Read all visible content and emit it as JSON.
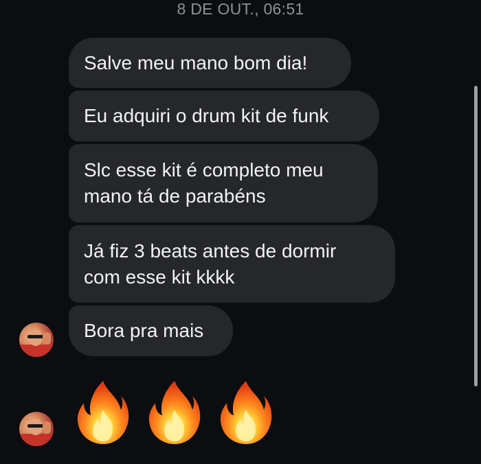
{
  "chat": {
    "timestamp": "8 DE OUT., 06:51",
    "messages": [
      {
        "lines": [
          "Salve meu mano bom dia!"
        ]
      },
      {
        "lines": [
          "Eu adquiri o drum kit de funk"
        ]
      },
      {
        "lines": [
          "Slc esse kit é completo meu",
          "mano tá de parabéns"
        ]
      },
      {
        "lines": [
          "Já fiz 3 beats antes de dormir",
          "com esse kit kkkk"
        ]
      },
      {
        "lines": [
          "Bora pra mais"
        ]
      }
    ],
    "reaction": "🔥🔥🔥",
    "reaction_icon": "fire-icon",
    "colors": {
      "background": "#0b0d10",
      "bubble": "#25272b",
      "text": "#f2f3f5",
      "timestamp": "#8e9297"
    }
  }
}
